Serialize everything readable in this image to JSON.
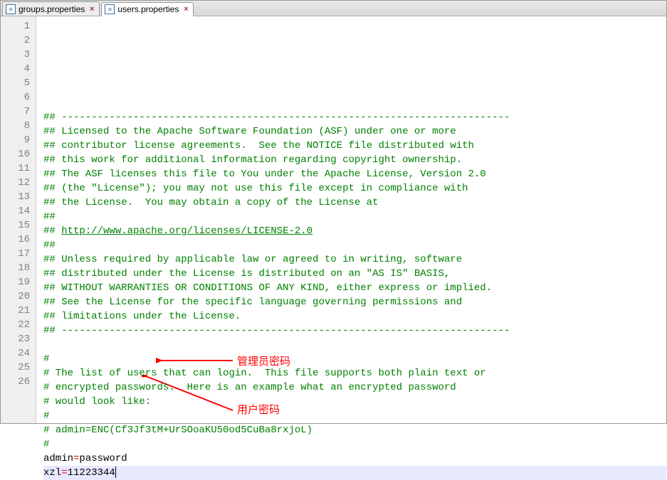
{
  "tabs": [
    {
      "label": "groups.properties",
      "active": false
    },
    {
      "label": "users.properties",
      "active": true
    }
  ],
  "lines": [
    {
      "n": 1,
      "t": "comment",
      "text": "## ---------------------------------------------------------------------------"
    },
    {
      "n": 2,
      "t": "comment",
      "text": "## Licensed to the Apache Software Foundation (ASF) under one or more"
    },
    {
      "n": 3,
      "t": "comment",
      "text": "## contributor license agreements.  See the NOTICE file distributed with"
    },
    {
      "n": 4,
      "t": "comment",
      "text": "## this work for additional information regarding copyright ownership."
    },
    {
      "n": 5,
      "t": "comment",
      "text": "## The ASF licenses this file to You under the Apache License, Version 2.0"
    },
    {
      "n": 6,
      "t": "comment",
      "text": "## (the \"License\"); you may not use this file except in compliance with"
    },
    {
      "n": 7,
      "t": "comment",
      "text": "## the License.  You may obtain a copy of the License at"
    },
    {
      "n": 8,
      "t": "comment",
      "text": "##"
    },
    {
      "n": 9,
      "t": "url",
      "prefix": "## ",
      "url": "http://www.apache.org/licenses/LICENSE-2.0"
    },
    {
      "n": 10,
      "t": "comment",
      "text": "##"
    },
    {
      "n": 11,
      "t": "comment",
      "text": "## Unless required by applicable law or agreed to in writing, software"
    },
    {
      "n": 12,
      "t": "comment",
      "text": "## distributed under the License is distributed on an \"AS IS\" BASIS,"
    },
    {
      "n": 13,
      "t": "comment",
      "text": "## WITHOUT WARRANTIES OR CONDITIONS OF ANY KIND, either express or implied."
    },
    {
      "n": 14,
      "t": "comment",
      "text": "## See the License for the specific language governing permissions and"
    },
    {
      "n": 15,
      "t": "comment",
      "text": "## limitations under the License."
    },
    {
      "n": 16,
      "t": "comment",
      "text": "## ---------------------------------------------------------------------------"
    },
    {
      "n": 17,
      "t": "blank",
      "text": ""
    },
    {
      "n": 18,
      "t": "comment",
      "text": "#"
    },
    {
      "n": 19,
      "t": "comment",
      "text": "# The list of users that can login.  This file supports both plain text or"
    },
    {
      "n": 20,
      "t": "comment",
      "text": "# encrypted passwords.  Here is an example what an encrypted password"
    },
    {
      "n": 21,
      "t": "comment",
      "text": "# would look like:"
    },
    {
      "n": 22,
      "t": "comment",
      "text": "#"
    },
    {
      "n": 23,
      "t": "comment",
      "text": "# admin=ENC(Cf3Jf3tM+UrSOoaKU50od5CuBa8rxjoL)"
    },
    {
      "n": 24,
      "t": "comment",
      "text": "#"
    },
    {
      "n": 25,
      "t": "kv",
      "key": "admin",
      "val": "password"
    },
    {
      "n": 26,
      "t": "kv",
      "key": "xzl",
      "val": "11223344",
      "current": true,
      "cursor": true
    }
  ],
  "annotations": {
    "admin": "管理员密码",
    "user": "用户密码"
  }
}
